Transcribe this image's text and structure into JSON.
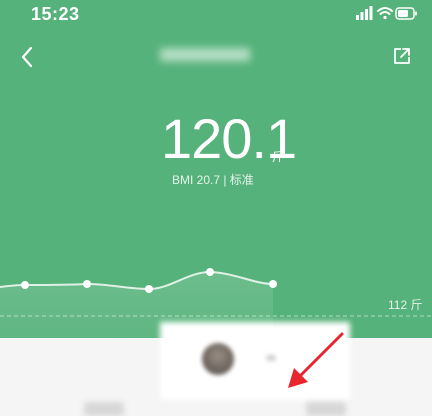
{
  "status_bar": {
    "time": "15:23",
    "icons": [
      "signal-icon",
      "wifi-icon",
      "battery-icon"
    ]
  },
  "nav": {
    "back_icon": "chevron-left-icon",
    "share_icon": "share-icon"
  },
  "summary": {
    "weight": "120.1",
    "unit": "斤",
    "bmi_text": "BMI 20.7 | 标准"
  },
  "trend": {
    "reference_label": "112 斤"
  },
  "colors": {
    "header_green": "#55b27a",
    "arrow_red": "#e8262e"
  }
}
